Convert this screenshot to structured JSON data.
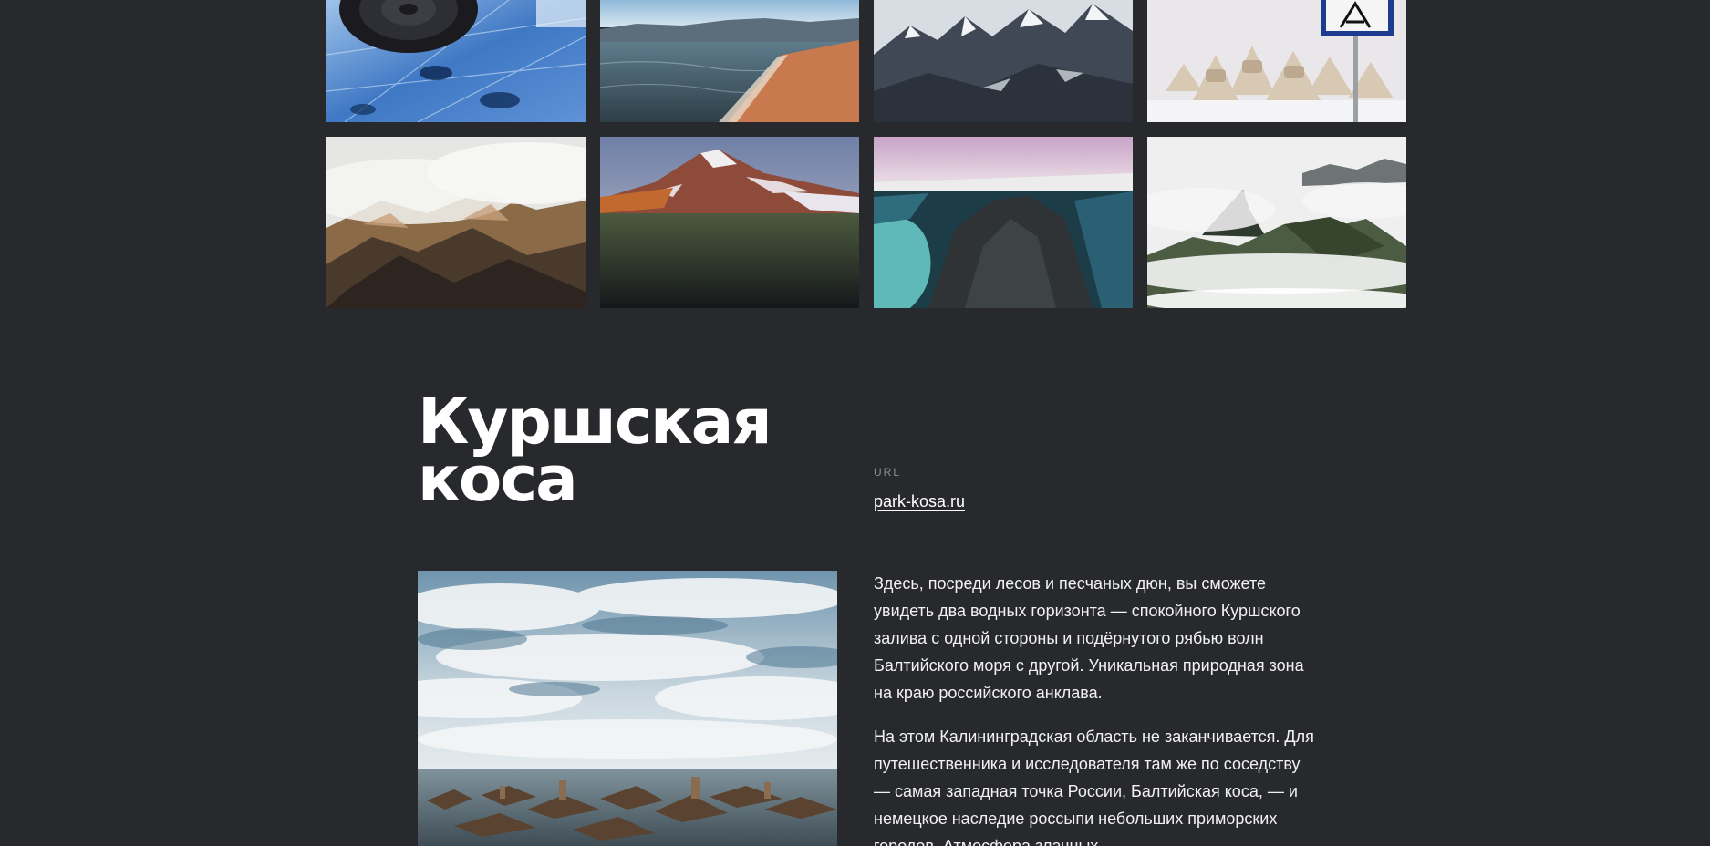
{
  "gallery": {
    "items": [
      {
        "alt": "ice-tire-photo"
      },
      {
        "alt": "lake-shore-photo"
      },
      {
        "alt": "snowy-peaks-photo"
      },
      {
        "alt": "breakwater-sign-photo"
      },
      {
        "alt": "foggy-hills-photo"
      },
      {
        "alt": "volcano-photo"
      },
      {
        "alt": "canyon-river-photo"
      },
      {
        "alt": "misty-peaks-photo"
      }
    ]
  },
  "section": {
    "title_line1": "Куршская",
    "title_line2": "коса",
    "url_label": "URL",
    "url_text": "park-kosa.ru",
    "paragraph1": "Здесь, посреди лесов и песчаных дюн, вы сможете увидеть два водных горизонта — спокойного Куршского залива с одной стороны и подёрнутого рябью волн Балтийского моря с другой. Уникальная природная зона на краю российского анклава.",
    "paragraph2": "На этом Калининградская область не заканчивается. Для путешественника и исследователя там же по соседству — самая западная точка России, Балтийская коса, — и немецкое наследие россыпи небольших приморских городов. Атмосфера злачных"
  },
  "colors": {
    "background": "#28292d",
    "muted": "#8b8d92",
    "text": "#ffffff"
  }
}
